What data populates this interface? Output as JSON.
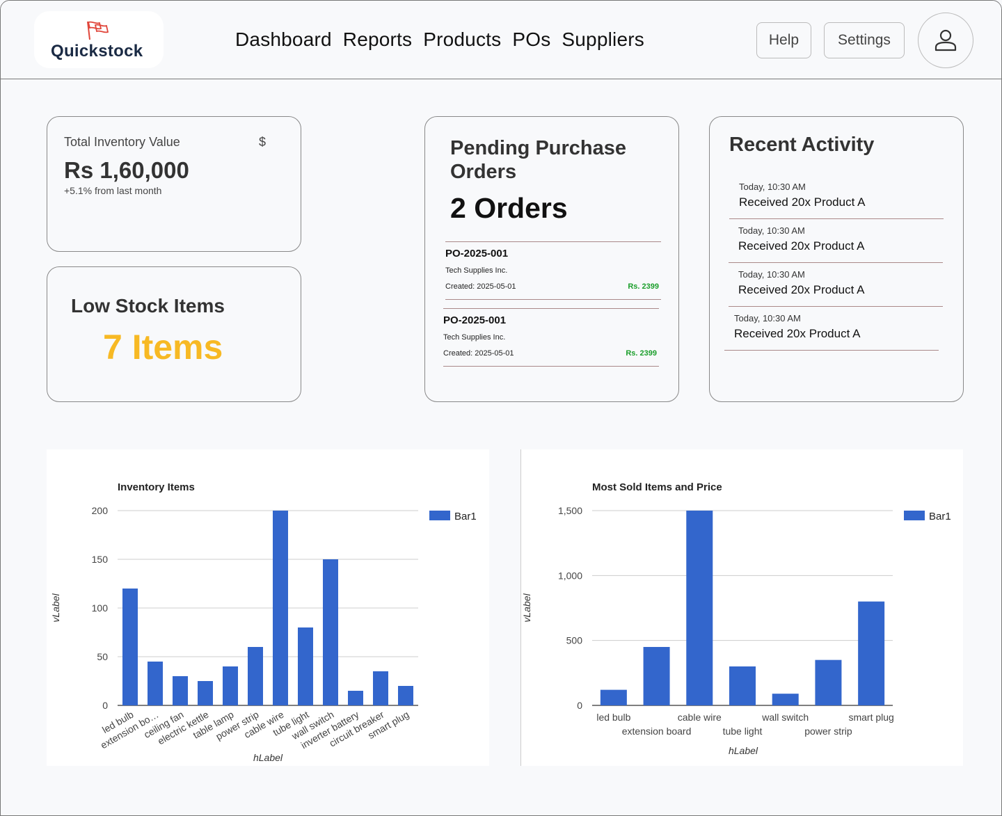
{
  "app": {
    "name": "Quickstock"
  },
  "nav": {
    "items": [
      "Dashboard",
      "Reports",
      "Products",
      "POs",
      "Suppliers"
    ]
  },
  "header": {
    "help_label": "Help",
    "settings_label": "Settings"
  },
  "inventory_card": {
    "label": "Total Inventory Value",
    "currency_symbol": "$",
    "value": "Rs 1,60,000",
    "change": "+5.1% from last month"
  },
  "low_stock_card": {
    "title": "Low Stock Items",
    "value": "7 Items"
  },
  "po_card": {
    "title": "Pending Purchase Orders",
    "count": "2 Orders",
    "orders": [
      {
        "id": "PO-2025-001",
        "supplier": "Tech Supplies Inc.",
        "created": "Created: 2025-05-01",
        "amount": "Rs. 2399"
      },
      {
        "id": "PO-2025-001",
        "supplier": "Tech Supplies Inc.",
        "created": "Created: 2025-05-01",
        "amount": "Rs. 2399"
      }
    ]
  },
  "activity_card": {
    "title": "Recent Activity",
    "items": [
      {
        "time": "Today, 10:30 AM",
        "text": "Received 20x Product A"
      },
      {
        "time": "Today, 10:30 AM",
        "text": "Received 20x Product A"
      },
      {
        "time": "Today, 10:30 AM",
        "text": "Received 20x Product A"
      },
      {
        "time": "Today, 10:30 AM",
        "text": "Received 20x Product A"
      }
    ]
  },
  "colors": {
    "bar": "#3366cc",
    "low_stock": "#f7b924",
    "amount": "#1a9e2a"
  },
  "chart_data": [
    {
      "type": "bar",
      "title": "Inventory Items",
      "xlabel": "hLabel",
      "ylabel": "vLabel",
      "categories": [
        "led bulb",
        "extension bo…",
        "ceiling fan",
        "electric kettle",
        "table lamp",
        "power strip",
        "cable wire",
        "tube light",
        "wall switch",
        "inverter battery",
        "circuit breaker",
        "smart plug"
      ],
      "series": [
        {
          "name": "Bar1",
          "values": [
            120,
            45,
            30,
            25,
            40,
            60,
            200,
            80,
            150,
            15,
            35,
            20
          ]
        }
      ],
      "ylim": [
        0,
        200
      ],
      "yticks": [
        0,
        50,
        100,
        150,
        200
      ],
      "ytick_labels": [
        "0",
        "50",
        "100",
        "150",
        "200"
      ],
      "legend": "right",
      "grid": true
    },
    {
      "type": "bar",
      "title": "Most Sold Items and Price",
      "xlabel": "hLabel",
      "ylabel": "vLabel",
      "categories": [
        "led bulb",
        "extension board",
        "cable wire",
        "tube light",
        "wall switch",
        "power strip",
        "smart plug"
      ],
      "series": [
        {
          "name": "Bar1",
          "values": [
            120,
            450,
            1500,
            300,
            90,
            350,
            800
          ]
        }
      ],
      "ylim": [
        0,
        1500
      ],
      "yticks": [
        0,
        500,
        1000,
        1500
      ],
      "ytick_labels": [
        "0",
        "500",
        "1,000",
        "1,500"
      ],
      "legend": "right",
      "grid": true
    }
  ]
}
